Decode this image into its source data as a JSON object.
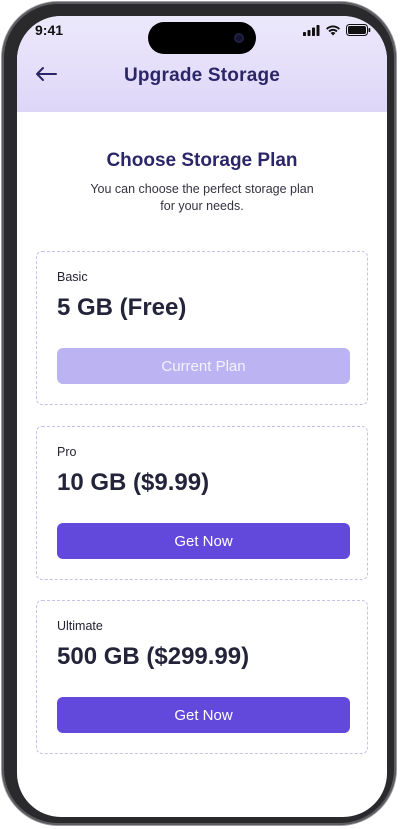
{
  "status_bar": {
    "time": "9:41",
    "icons": [
      "signal-icon",
      "wifi-icon",
      "battery-icon"
    ]
  },
  "header": {
    "back_icon": "back-arrow-icon",
    "title": "Upgrade Storage"
  },
  "intro": {
    "title": "Choose Storage Plan",
    "subtitle": "You can choose the perfect storage plan for your needs."
  },
  "plans": [
    {
      "name": "Basic",
      "size": "5 GB (Free)",
      "button_label": "Current Plan",
      "is_current": true
    },
    {
      "name": "Pro",
      "size": "10 GB ($9.99)",
      "button_label": "Get Now",
      "is_current": false
    },
    {
      "name": "Ultimate",
      "size": "500 GB ($299.99)",
      "button_label": "Get Now",
      "is_current": false
    }
  ],
  "colors": {
    "accent": "#6249dc",
    "accent_disabled": "#bcb3f3",
    "title_text": "#2b2668",
    "header_bg": "#e4defa"
  }
}
